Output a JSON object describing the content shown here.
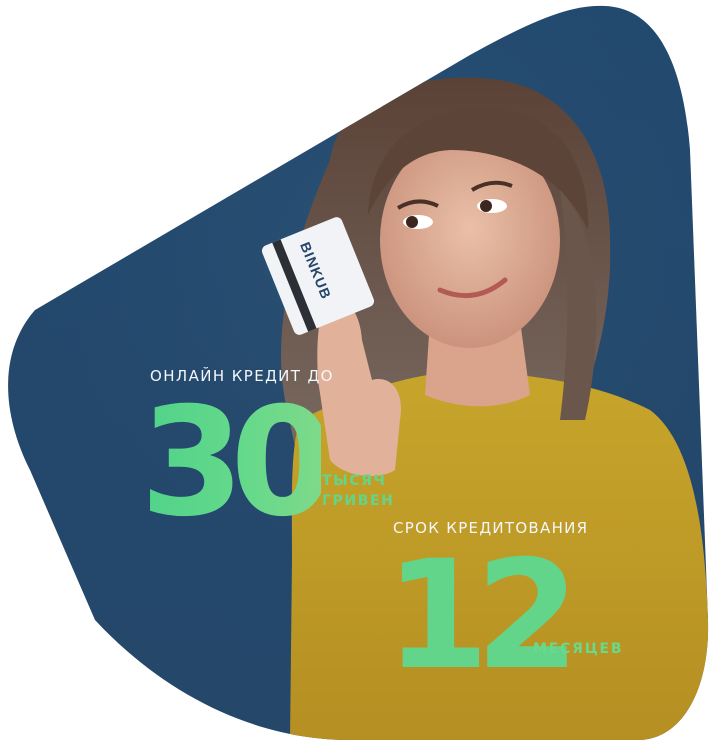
{
  "colors": {
    "background": "#24496d",
    "accent_green": "#5fd68a",
    "label_white": "#f4f7fb",
    "shirt_yellow": "#c5a52a"
  },
  "card": {
    "brand": "BINKUB"
  },
  "offer": {
    "amount_label": "ОНЛАЙН КРЕДИТ ДО",
    "amount_value": "30",
    "amount_unit_line1": "ТЫСЯЧ",
    "amount_unit_line2": "ГРИВЕН",
    "term_label": "СРОК КРЕДИТОВАНИЯ",
    "term_value": "12",
    "term_unit": "МЕСЯЦЕВ"
  }
}
